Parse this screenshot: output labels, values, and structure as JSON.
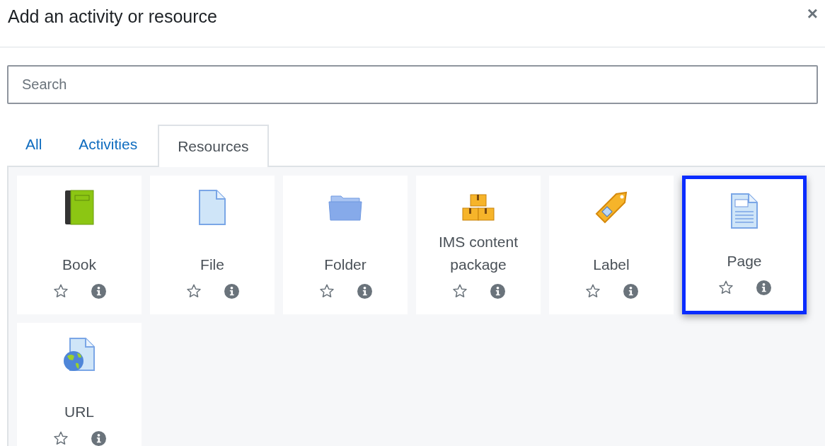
{
  "dialog": {
    "title": "Add an activity or resource",
    "close": "×"
  },
  "search": {
    "placeholder": "Search"
  },
  "tabs": [
    {
      "label": "All",
      "selected": false
    },
    {
      "label": "Activities",
      "selected": false
    },
    {
      "label": "Resources",
      "selected": true
    }
  ],
  "items": [
    {
      "kind": "book",
      "label": "Book",
      "selected": false,
      "starred": false
    },
    {
      "kind": "file",
      "label": "File",
      "selected": false,
      "starred": false
    },
    {
      "kind": "folder",
      "label": "Folder",
      "selected": false,
      "starred": false
    },
    {
      "kind": "package",
      "label": "IMS content package",
      "selected": false,
      "starred": false
    },
    {
      "kind": "label",
      "label": "Label",
      "selected": false,
      "starred": false
    },
    {
      "kind": "page",
      "label": "Page",
      "selected": true,
      "starred": false
    },
    {
      "kind": "url",
      "label": "URL",
      "selected": false,
      "starred": false
    }
  ]
}
